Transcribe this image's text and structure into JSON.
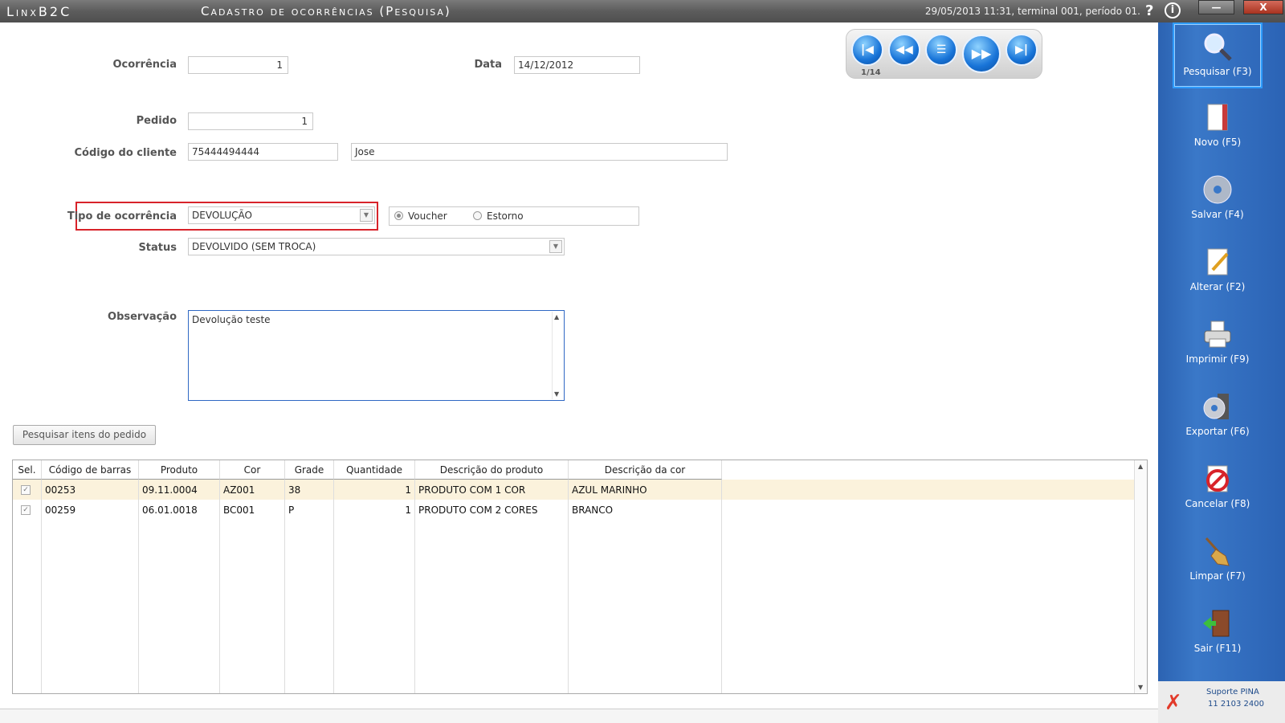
{
  "window": {
    "brand": "LinxB2C",
    "title": "Cadastro de ocorrências (Pesquisa)",
    "session": "29/05/2013 11:31, terminal 001, período 01.",
    "help_glyph": "?",
    "info_glyph": "i",
    "minimize_glyph": "—",
    "close_glyph": "X"
  },
  "navigator": {
    "counter": "1/14",
    "buttons": [
      "first",
      "previous",
      "current",
      "next",
      "last"
    ]
  },
  "form": {
    "ocorrencia": {
      "label": "Ocorrência",
      "value": "1"
    },
    "data": {
      "label": "Data",
      "value": "14/12/2012"
    },
    "pedido": {
      "label": "Pedido",
      "value": "1"
    },
    "cliente": {
      "label": "Código do cliente",
      "code": "75444494444",
      "name": "Jose"
    },
    "tipo": {
      "label": "Tipo de ocorrência",
      "value": "DEVOLUÇÃO"
    },
    "reembolso": {
      "options": [
        {
          "label": "Voucher",
          "checked": true
        },
        {
          "label": "Estorno",
          "checked": false
        }
      ]
    },
    "status": {
      "label": "Status",
      "value": "DEVOLVIDO (SEM TROCA)"
    },
    "observacao": {
      "label": "Observação",
      "value": "Devolução teste"
    },
    "search_items_button": "Pesquisar itens do pedido"
  },
  "grid": {
    "columns": [
      "Sel.",
      "Código de barras",
      "Produto",
      "Cor",
      "Grade",
      "Quantidade",
      "Descrição do produto",
      "Descrição da cor"
    ],
    "rows": [
      {
        "sel": true,
        "barcode": "00253",
        "produto": "09.11.0004",
        "cor": "AZ001",
        "grade": "38",
        "quantidade": "1",
        "desc_produto": "PRODUTO COM 1 COR",
        "desc_cor": "AZUL MARINHO"
      },
      {
        "sel": true,
        "barcode": "00259",
        "produto": "06.01.0018",
        "cor": "BC001",
        "grade": "P",
        "quantidade": "1",
        "desc_produto": "PRODUTO COM 2 CORES",
        "desc_cor": "BRANCO"
      }
    ],
    "selected_row_color": "#fbf2dc"
  },
  "sidebar": {
    "buttons": [
      {
        "label": "Pesquisar (F3)",
        "icon": "magnifier-icon",
        "active": true
      },
      {
        "label": "Novo (F5)",
        "icon": "new-document-icon"
      },
      {
        "label": "Salvar (F4)",
        "icon": "disc-icon"
      },
      {
        "label": "Alterar (F2)",
        "icon": "edit-pencil-icon"
      },
      {
        "label": "Imprimir (F9)",
        "icon": "printer-icon"
      },
      {
        "label": "Exportar (F6)",
        "icon": "export-disc-icon"
      },
      {
        "label": "Cancelar (F8)",
        "icon": "cancel-icon"
      },
      {
        "label": "Limpar (F7)",
        "icon": "broom-icon"
      },
      {
        "label": "Sair (F11)",
        "icon": "exit-door-icon"
      }
    ],
    "support": {
      "line1": "Suporte PINA",
      "line2": "11 2103 2400"
    },
    "accent": "#2c63b2"
  }
}
